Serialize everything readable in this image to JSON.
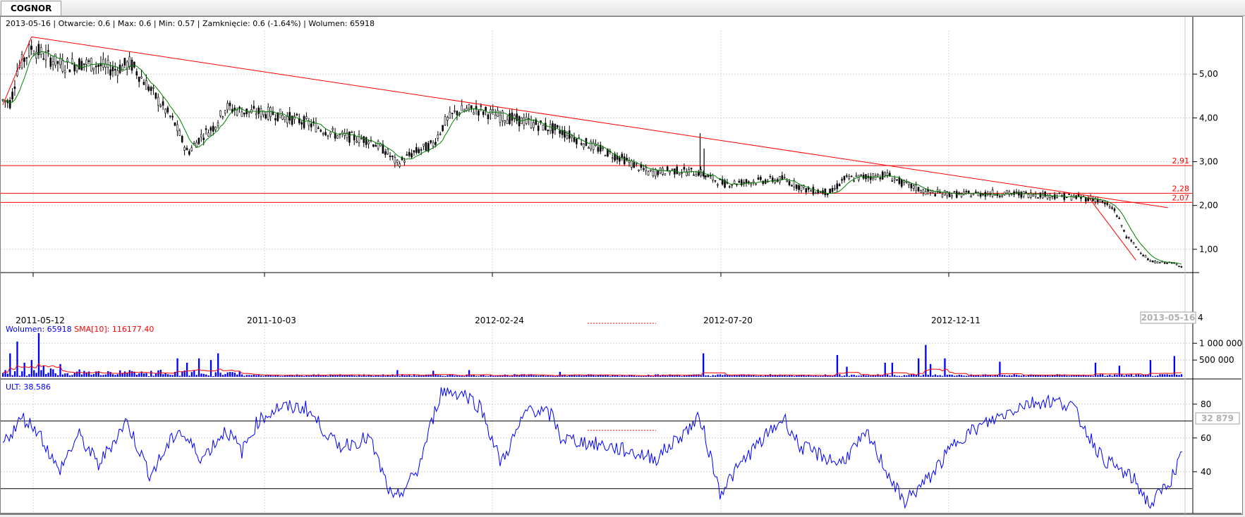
{
  "tab": {
    "label": "COGNOR"
  },
  "header": {
    "date": "2013-05-16",
    "open": "Otwarcie: 0.6",
    "max": "Max: 0.6",
    "min": "Min: 0.57",
    "close": "Zamknięcie: 0.6 (-1.64%)",
    "volume": "Wolumen: 65918"
  },
  "volume_legend": {
    "volume": "Wolumen: 65918",
    "sma": "SMA[10]: 116177.40"
  },
  "ult_legend": "ULT: 38.586",
  "cursor_date": "2013-05-16",
  "cursor_volume": "32 879",
  "colors": {
    "trend": "#ff0000",
    "sma": "#008000",
    "volume_bar": "#0000ff",
    "volume_sma": "#ff0000",
    "ult": "#0000ff",
    "candle": "#000000"
  },
  "chart_data": [
    {
      "type": "line",
      "title": "COGNOR",
      "x_ticks": [
        "2011-05-12",
        "2011-10-03",
        "2012-02-24",
        "2012-07-20",
        "2012-12-11"
      ],
      "y_ticks": [
        "1,00",
        "2,00",
        "3,00",
        "4,00",
        "5,00"
      ],
      "ylim": [
        0.5,
        6.0
      ],
      "grid": true,
      "levels": [
        {
          "label": "2,91",
          "value": 2.91
        },
        {
          "label": "2,28",
          "value": 2.28
        },
        {
          "label": "2,07",
          "value": 2.07
        }
      ],
      "trendlines": [
        {
          "from": [
            0,
            4.3
          ],
          "to": [
            36,
            5.85
          ]
        },
        {
          "from": [
            36,
            5.85
          ],
          "to": [
            1462,
            1.95
          ]
        },
        {
          "from": [
            1362,
            2.2
          ],
          "to": [
            1422,
            0.75
          ]
        }
      ],
      "x_anchor_index": [
        0,
        1480
      ],
      "price_keypoints": [
        [
          0,
          4.4
        ],
        [
          10,
          4.35
        ],
        [
          18,
          5.1
        ],
        [
          36,
          5.6
        ],
        [
          55,
          5.4
        ],
        [
          75,
          5.2
        ],
        [
          100,
          5.25
        ],
        [
          120,
          5.2
        ],
        [
          140,
          5.1
        ],
        [
          160,
          5.25
        ],
        [
          175,
          4.9
        ],
        [
          195,
          4.4
        ],
        [
          215,
          3.9
        ],
        [
          232,
          3.2
        ],
        [
          250,
          3.6
        ],
        [
          265,
          3.8
        ],
        [
          280,
          4.25
        ],
        [
          300,
          4.15
        ],
        [
          340,
          4.1
        ],
        [
          380,
          3.9
        ],
        [
          420,
          3.6
        ],
        [
          460,
          3.5
        ],
        [
          480,
          3.25
        ],
        [
          495,
          2.95
        ],
        [
          515,
          3.2
        ],
        [
          540,
          3.4
        ],
        [
          555,
          3.9
        ],
        [
          570,
          4.15
        ],
        [
          595,
          4.2
        ],
        [
          620,
          4.05
        ],
        [
          660,
          3.9
        ],
        [
          700,
          3.7
        ],
        [
          740,
          3.35
        ],
        [
          780,
          3.05
        ],
        [
          810,
          2.75
        ],
        [
          840,
          2.8
        ],
        [
          875,
          2.75
        ],
        [
          892,
          2.6
        ],
        [
          905,
          2.5
        ],
        [
          940,
          2.55
        ],
        [
          980,
          2.6
        ],
        [
          1010,
          2.35
        ],
        [
          1040,
          2.3
        ],
        [
          1055,
          2.6
        ],
        [
          1080,
          2.65
        ],
        [
          1110,
          2.7
        ],
        [
          1130,
          2.5
        ],
        [
          1160,
          2.3
        ],
        [
          1200,
          2.25
        ],
        [
          1240,
          2.28
        ],
        [
          1300,
          2.25
        ],
        [
          1340,
          2.2
        ],
        [
          1372,
          2.15
        ],
        [
          1395,
          1.9
        ],
        [
          1410,
          1.3
        ],
        [
          1425,
          1.0
        ],
        [
          1440,
          0.72
        ],
        [
          1470,
          0.68
        ],
        [
          1480,
          0.6
        ]
      ]
    },
    {
      "type": "bar",
      "series_name": "Wolumen",
      "y_ticks": [
        "500 000",
        "1 000 000"
      ],
      "ylim": [
        0,
        1300000
      ],
      "spikes": [
        [
          10,
          700000
        ],
        [
          18,
          1050000
        ],
        [
          28,
          420000
        ],
        [
          36,
          500000
        ],
        [
          45,
          1300000
        ],
        [
          52,
          330000
        ],
        [
          60,
          250000
        ],
        [
          72,
          380000
        ],
        [
          95,
          220000
        ],
        [
          160,
          200000
        ],
        [
          185,
          180000
        ],
        [
          220,
          550000
        ],
        [
          232,
          420000
        ],
        [
          247,
          550000
        ],
        [
          262,
          500000
        ],
        [
          270,
          700000
        ],
        [
          495,
          200000
        ],
        [
          540,
          180000
        ],
        [
          585,
          200000
        ],
        [
          700,
          150000
        ],
        [
          880,
          700000
        ],
        [
          1047,
          650000
        ],
        [
          1060,
          300000
        ],
        [
          1108,
          420000
        ],
        [
          1115,
          420000
        ],
        [
          1150,
          550000
        ],
        [
          1158,
          950000
        ],
        [
          1165,
          380000
        ],
        [
          1182,
          550000
        ],
        [
          1250,
          450000
        ],
        [
          1370,
          420000
        ],
        [
          1400,
          330000
        ],
        [
          1440,
          500000
        ],
        [
          1470,
          620000
        ]
      ],
      "last_value": 65918
    },
    {
      "type": "line",
      "series_name": "ULT",
      "y_ticks": [
        "40",
        "60",
        "80"
      ],
      "ylim": [
        17,
        92
      ],
      "reference_lines": [
        70,
        30
      ],
      "keypoints": [
        [
          0,
          57
        ],
        [
          25,
          72
        ],
        [
          45,
          64
        ],
        [
          70,
          40
        ],
        [
          95,
          62
        ],
        [
          120,
          44
        ],
        [
          155,
          70
        ],
        [
          185,
          38
        ],
        [
          220,
          65
        ],
        [
          250,
          48
        ],
        [
          280,
          65
        ],
        [
          300,
          52
        ],
        [
          320,
          70
        ],
        [
          345,
          78
        ],
        [
          380,
          78
        ],
        [
          420,
          55
        ],
        [
          460,
          60
        ],
        [
          490,
          22
        ],
        [
          520,
          40
        ],
        [
          550,
          88
        ],
        [
          580,
          86
        ],
        [
          600,
          78
        ],
        [
          625,
          45
        ],
        [
          660,
          78
        ],
        [
          690,
          73
        ],
        [
          700,
          60
        ],
        [
          760,
          55
        ],
        [
          820,
          48
        ],
        [
          875,
          72
        ],
        [
          900,
          28
        ],
        [
          935,
          50
        ],
        [
          980,
          72
        ],
        [
          1000,
          55
        ],
        [
          1050,
          45
        ],
        [
          1085,
          62
        ],
        [
          1130,
          22
        ],
        [
          1160,
          35
        ],
        [
          1200,
          60
        ],
        [
          1240,
          70
        ],
        [
          1280,
          80
        ],
        [
          1310,
          82
        ],
        [
          1340,
          80
        ],
        [
          1380,
          48
        ],
        [
          1420,
          35
        ],
        [
          1440,
          20
        ],
        [
          1465,
          35
        ],
        [
          1480,
          50
        ]
      ],
      "last_value": 38.586
    }
  ]
}
